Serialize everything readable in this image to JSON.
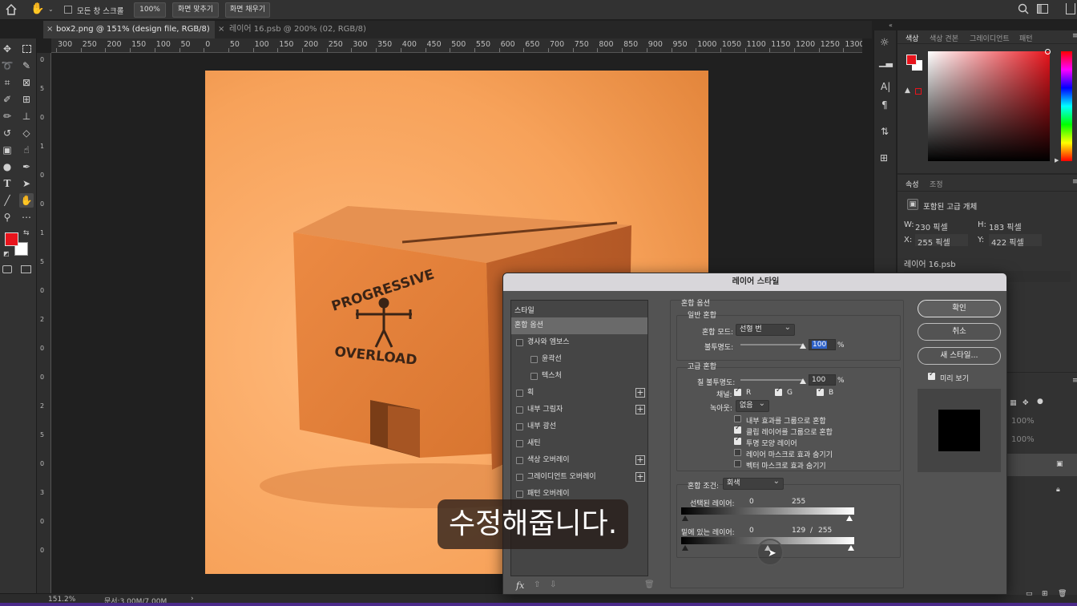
{
  "options_bar": {
    "all_windows_label": "모든 창 스크롤",
    "zoom_button": "100%",
    "fit_screen_button": "화면 맞추기",
    "fill_screen_button": "화면 채우기"
  },
  "tabs": [
    {
      "label": "box2.png @ 151% (design file, RGB/8) *",
      "active": true
    },
    {
      "label": "레이어 16.psb @ 200% (02, RGB/8)",
      "active": false
    }
  ],
  "ruler_labels": [
    "300",
    "250",
    "200",
    "150",
    "100",
    "50",
    "0",
    "50",
    "100",
    "150",
    "200",
    "250",
    "300",
    "350",
    "400",
    "450",
    "500",
    "550",
    "600",
    "650",
    "700",
    "750",
    "800",
    "850",
    "900",
    "950",
    "1000",
    "1050",
    "1100",
    "1150",
    "1200",
    "1250",
    "1300"
  ],
  "ruler_v_labels": [
    "0",
    "5",
    "0",
    "1",
    "0",
    "0",
    "1",
    "5",
    "0",
    "2",
    "0",
    "0",
    "2",
    "5",
    "0",
    "3",
    "0",
    "0"
  ],
  "artwork": {
    "box_text_top": "PROGRESSIVE",
    "box_text_bottom": "OVERLOAD"
  },
  "status_bar": {
    "zoom": "151.2%",
    "doc": "문서:3.00M/7.00M",
    "arrow": "›"
  },
  "color_panel": {
    "tabs": [
      "색상",
      "색상 견본",
      "그레이디언트",
      "패턴"
    ],
    "foreground": "#e8141c",
    "background": "#ffffff"
  },
  "properties_panel": {
    "tabs": [
      "속성",
      "조정"
    ],
    "type": "포함된 고급 개체",
    "w_label": "W:",
    "w_value": "230 픽셀",
    "h_label": "H:",
    "h_value": "183 픽셀",
    "x_label": "X:",
    "x_value": "255 픽셀",
    "y_label": "Y:",
    "y_value": "422 픽셀",
    "file": "레이어 16.psb"
  },
  "layers_panel": {
    "opacity_1": "100%",
    "opacity_2": "100%"
  },
  "dialog": {
    "title": "레이어 스타일",
    "styles_header": "스타일",
    "style_items": [
      {
        "label": "혼합 옵션",
        "checkbox": false,
        "plus": false,
        "selected": true,
        "indent": false
      },
      {
        "label": "경사와 엠보스",
        "checkbox": true,
        "plus": false,
        "selected": false,
        "indent": false
      },
      {
        "label": "윤곽선",
        "checkbox": true,
        "plus": false,
        "selected": false,
        "indent": true
      },
      {
        "label": "텍스처",
        "checkbox": true,
        "plus": false,
        "selected": false,
        "indent": true
      },
      {
        "label": "획",
        "checkbox": true,
        "plus": true,
        "selected": false,
        "indent": false
      },
      {
        "label": "내부 그림자",
        "checkbox": true,
        "plus": true,
        "selected": false,
        "indent": false
      },
      {
        "label": "내부 광선",
        "checkbox": true,
        "plus": false,
        "selected": false,
        "indent": false
      },
      {
        "label": "새틴",
        "checkbox": true,
        "plus": false,
        "selected": false,
        "indent": false
      },
      {
        "label": "색상 오버레이",
        "checkbox": true,
        "plus": true,
        "selected": false,
        "indent": false
      },
      {
        "label": "그레이디언트 오버레이",
        "checkbox": true,
        "plus": true,
        "selected": false,
        "indent": false
      },
      {
        "label": "패턴 오버레이",
        "checkbox": true,
        "plus": false,
        "selected": false,
        "indent": false
      }
    ],
    "fx_label": "fx",
    "blend_options_title": "혼합 옵션",
    "general_blending_title": "일반 혼합",
    "blend_mode_label": "혼합 모드:",
    "blend_mode_value": "선형 번",
    "opacity_label": "불투명도:",
    "opacity_value": "100",
    "opacity_fraction": 1.0,
    "percent": "%",
    "advanced_blending_title": "고급 혼합",
    "fill_opacity_label": "칠 불투명도:",
    "fill_opacity_value": "100",
    "fill_opacity_fraction": 1.0,
    "channels_label": "채널:",
    "channel_r": "R",
    "channel_g": "G",
    "channel_b": "B",
    "knockout_label": "녹아웃:",
    "knockout_value": "없음",
    "adv_options": [
      {
        "label": "내부 효과를 그룹으로 혼합",
        "checked": false
      },
      {
        "label": "클립 레이어를 그룹으로 혼합",
        "checked": true
      },
      {
        "label": "투명 모양 레이어",
        "checked": true
      },
      {
        "label": "레이어 마스크로 효과 숨기기",
        "checked": false
      },
      {
        "label": "벡터 마스크로 효과 숨기기",
        "checked": false
      }
    ],
    "blend_if_label": "혼합 조건:",
    "blend_if_value": "회색",
    "this_layer_label": "선택된 레이어:",
    "this_layer_low": "0",
    "this_layer_high": "255",
    "underlying_label": "밑에 있는 레이어:",
    "underlying_low": "0",
    "underlying_split": "129",
    "underlying_slash": "/",
    "underlying_high": "255",
    "ok_button": "확인",
    "cancel_button": "취소",
    "new_style_button": "새 스타일...",
    "preview_label": "미리 보기"
  },
  "subtitle": "수정해줍니다."
}
